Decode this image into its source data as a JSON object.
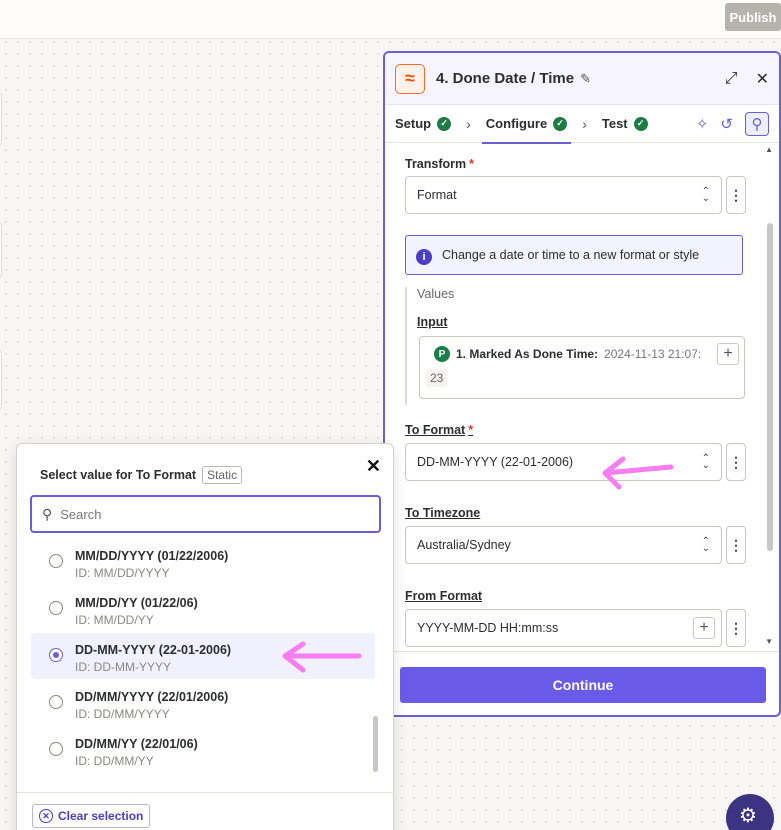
{
  "toolbar": {
    "publish_label": "Publish"
  },
  "panel": {
    "title": "4. Done Date / Time",
    "icon_glyph": "≈",
    "tabs": [
      {
        "label": "Setup"
      },
      {
        "label": "Configure"
      },
      {
        "label": "Test"
      }
    ],
    "transform": {
      "label": "Transform",
      "value": "Format"
    },
    "info_text": "Change a date or time to a new format or style",
    "values_title": "Values",
    "input": {
      "label": "Input",
      "pill_badge": "P",
      "pill_label": "1. Marked As Done Time:",
      "pill_value": "2024-11-13 21:07:",
      "pill_cont": "23"
    },
    "to_format": {
      "label": "To Format",
      "value": "DD-MM-YYYY (22-01-2006)"
    },
    "to_timezone": {
      "label": "To Timezone",
      "value": "Australia/Sydney"
    },
    "from_format": {
      "label": "From Format",
      "value": "YYYY-MM-DD HH:mm:ss"
    },
    "required_mark": "*",
    "continue_label": "Continue"
  },
  "popover": {
    "title": "Select value for To Format",
    "tag": "Static",
    "search_placeholder": "Search",
    "options": [
      {
        "label": "MM/DD/YYYY (01/22/2006)",
        "id": "ID: MM/DD/YYYY",
        "selected": false
      },
      {
        "label": "MM/DD/YY (01/22/06)",
        "id": "ID: MM/DD/YY",
        "selected": false
      },
      {
        "label": "DD-MM-YYYY (22-01-2006)",
        "id": "ID: DD-MM-YYYY",
        "selected": true
      },
      {
        "label": "DD/MM/YYYY (22/01/2006)",
        "id": "ID: DD/MM/YYYY",
        "selected": false
      },
      {
        "label": "DD/MM/YY (22/01/06)",
        "id": "ID: DD/MM/YY",
        "selected": false
      }
    ],
    "clear_label": "Clear selection"
  },
  "colors": {
    "accent": "#6a5fd6",
    "button": "#695be8",
    "success": "#1e7d46",
    "annotation_arrow": "#f77ef0",
    "app_icon": "#ff4f00"
  }
}
